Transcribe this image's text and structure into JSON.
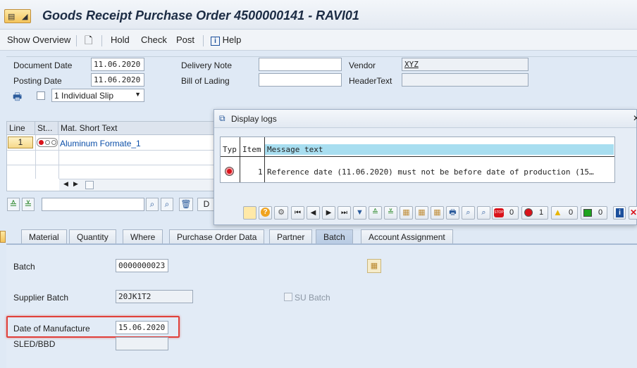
{
  "window": {
    "title": "Goods Receipt Purchase Order 4500000141 - RAVI01"
  },
  "toolbar": {
    "show_overview": "Show Overview",
    "hold": "Hold",
    "check": "Check",
    "post": "Post",
    "help": "Help"
  },
  "header": {
    "document_date_label": "Document Date",
    "document_date": "11.06.2020",
    "posting_date_label": "Posting Date",
    "posting_date": "11.06.2020",
    "delivery_note_label": "Delivery Note",
    "delivery_note": "",
    "bill_of_lading_label": "Bill of Lading",
    "bill_of_lading": "",
    "vendor_label": "Vendor",
    "vendor": "XYZ",
    "header_text_label": "HeaderText",
    "header_text": "",
    "slip_option": "1 Individual Slip"
  },
  "items": {
    "columns": [
      "Line",
      "St...",
      "Mat. Short Text"
    ],
    "rows": [
      {
        "line": "1",
        "text": "Aluminum Formate_1"
      }
    ],
    "button_d": "D"
  },
  "popup": {
    "title": "Display logs",
    "columns": [
      "Typ",
      "Item",
      "Message text"
    ],
    "rows": [
      {
        "item": "1",
        "message": "Reference date (11.06.2020) must not be before date of production (15…"
      }
    ],
    "counts": {
      "stop": "0",
      "error": "1",
      "warning": "0",
      "success": "0"
    }
  },
  "tabs": [
    "Material",
    "Quantity",
    "Where",
    "Purchase Order Data",
    "Partner",
    "Batch",
    "Account Assignment"
  ],
  "batch_tab": {
    "batch_label": "Batch",
    "batch": "0000000023",
    "supplier_batch_label": "Supplier Batch",
    "supplier_batch": "20JK1T2",
    "su_batch_label": "SU Batch",
    "date_of_manufacture_label": "Date of Manufacture",
    "date_of_manufacture": "15.06.2020",
    "sled_label": "SLED/BBD",
    "sled": ""
  },
  "colors": {
    "highlight": "#e0403a",
    "accent": "#0a4ea8",
    "stop_red": "#d9131b"
  }
}
